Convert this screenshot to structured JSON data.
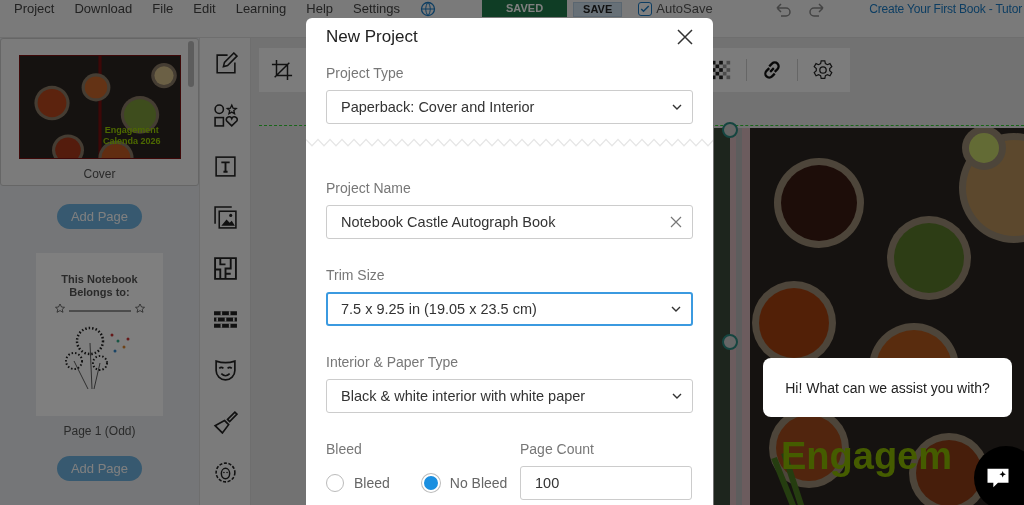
{
  "menu": [
    {
      "label": "Project"
    },
    {
      "label": "Download"
    },
    {
      "label": "File"
    },
    {
      "label": "Edit"
    },
    {
      "label": "Learning"
    },
    {
      "label": "Help"
    },
    {
      "label": "Settings"
    }
  ],
  "save_status": "SAVED",
  "save_button": "SAVE",
  "autosave": {
    "label": "AutoSave",
    "checked": true
  },
  "tutorial_link": "Create Your First Book - Tutor",
  "pages": [
    {
      "kind": "cover",
      "caption": "Cover",
      "title_lines": [
        "Engagement",
        "Calenda 2026"
      ],
      "selected": true,
      "add_button": "Add Page"
    },
    {
      "kind": "notebook",
      "caption": "Page 1 (Odd)",
      "title_lines": [
        "This Notebook",
        "Belongs to:"
      ],
      "selected": false,
      "add_button": "Add Page"
    }
  ],
  "canvas": {
    "headline": "Engagem"
  },
  "modal": {
    "title": "New Project",
    "project_type": {
      "label": "Project Type",
      "value": "Paperback: Cover and Interior"
    },
    "project_name": {
      "label": "Project Name",
      "value": "Notebook Castle Autograph Book"
    },
    "trim_size": {
      "label": "Trim Size",
      "value": "7.5 x 9.25 in (19.05 x 23.5 cm)",
      "focused": true
    },
    "interior": {
      "label": "Interior & Paper Type",
      "value": "Black & white interior with white paper",
      "focused": false
    },
    "bleed": {
      "label": "Bleed",
      "options": [
        {
          "label": "Bleed",
          "selected": false
        },
        {
          "label": "No Bleed",
          "selected": true
        }
      ]
    },
    "page_count": {
      "label": "Page Count",
      "value": "100"
    }
  },
  "chat": {
    "message": "Hi! What can we assist you with?"
  }
}
